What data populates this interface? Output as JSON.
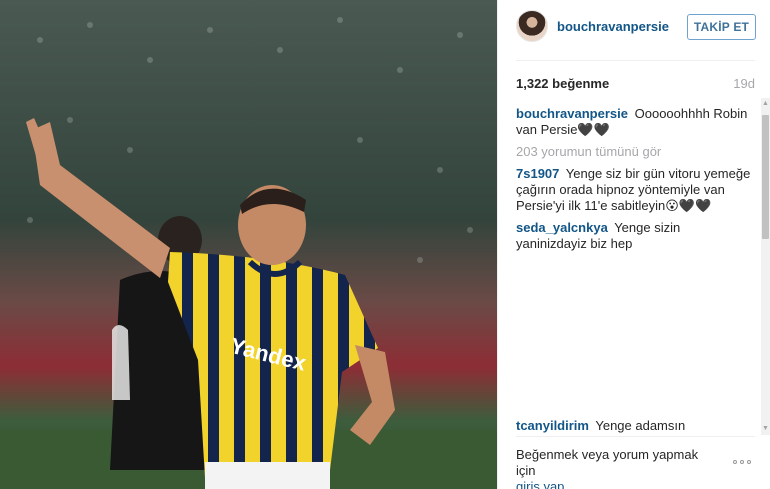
{
  "header": {
    "username": "bouchravanpersie",
    "follow_label": "TAKİP ET"
  },
  "stats": {
    "likes": "1,322 beğenme",
    "time": "19d"
  },
  "caption": {
    "user": "bouchravanpersie",
    "text": "Oooooohhhh Robin van Persie🖤🖤"
  },
  "view_all": "203 yorumun tümünü gör",
  "comments": [
    {
      "user": "7s1907",
      "text": "Yenge siz bir gün vitoru yemeğe çağırın orada hipnoz yöntemiyle van Persie'yi ilk 11'e sabitleyin😮🖤🖤"
    },
    {
      "user": "seda_yalcnkya",
      "text": "Yenge sizin yaninizdayiz biz hep"
    },
    {
      "user": "tcanyildirim",
      "text": "Yenge adamsın"
    }
  ],
  "footer": {
    "login_prompt": "Beğenmek veya yorum yapmak için",
    "login_link": "giriş yap."
  },
  "photo": {
    "jersey_sponsor": "Yandex",
    "jersey_colors": [
      "#f2d32b",
      "#14254d"
    ]
  }
}
